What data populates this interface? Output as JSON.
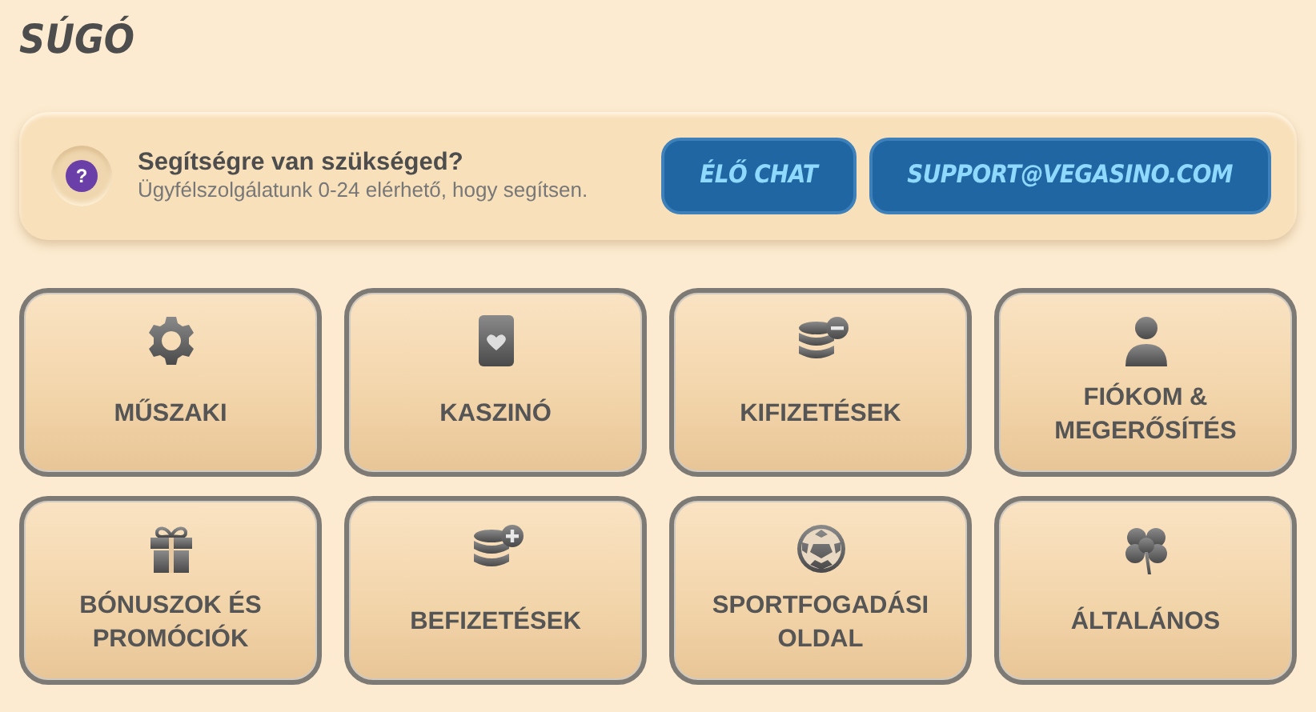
{
  "page": {
    "title": "SÚGÓ"
  },
  "help_banner": {
    "heading": "Segítségre van szükséged?",
    "subtext": "Ügyfélszolgálatunk 0-24 elérhető, hogy segítsen.",
    "icon": "?",
    "buttons": [
      "ÉLŐ CHAT",
      "SUPPORT@VEGASINO.COM"
    ]
  },
  "categories": [
    {
      "label": "MŰSZAKI"
    },
    {
      "label": "KASZINÓ"
    },
    {
      "label": "KIFIZETÉSEK"
    },
    {
      "label": "FIÓKOM & MEGERŐSÍTÉS"
    },
    {
      "label": "BÓNUSZOK ÉS PROMÓCIÓK"
    },
    {
      "label": "BEFIZETÉSEK"
    },
    {
      "label": "SPORTFOGADÁSI OLDAL"
    },
    {
      "label": "ÁLTALÁNOS"
    }
  ]
}
